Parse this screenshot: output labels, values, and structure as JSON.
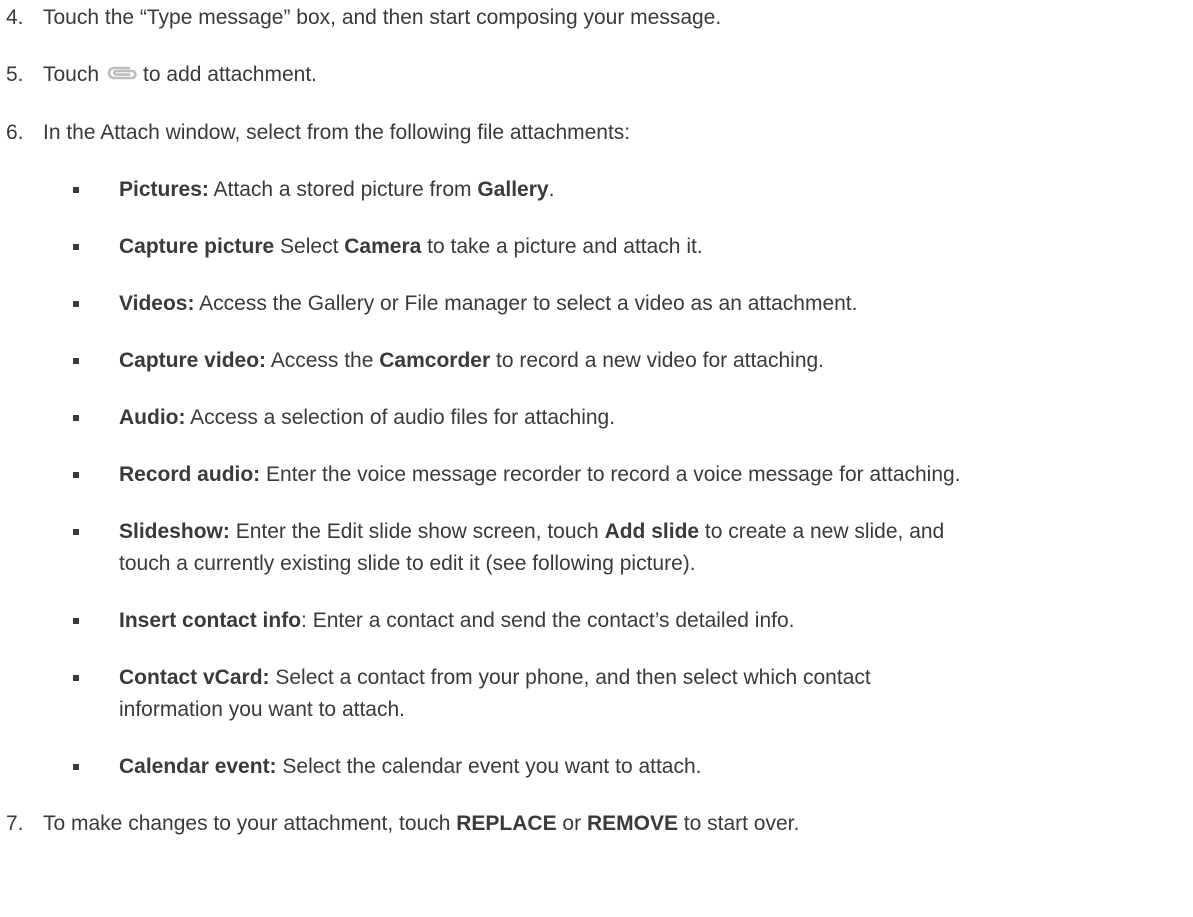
{
  "steps": [
    {
      "number": "4.",
      "text": "Touch the “Type message” box, and then start composing your message."
    },
    {
      "number": "5.",
      "text_before": "Touch",
      "icon": "paperclip-icon",
      "text_after": "to add attachment."
    },
    {
      "number": "6.",
      "text": "In the Attach window, select from the following file attachments:"
    },
    {
      "number": "7.",
      "text_before": "To make changes to your attachment, touch ",
      "bold1": "REPLACE",
      "text_middle": " or ",
      "bold2": "REMOVE",
      "text_after": " to start over."
    }
  ],
  "attachments": [
    {
      "label": "Pictures:",
      "text_a": " Attach a stored picture from ",
      "bold": "Gallery",
      "text_b": "."
    },
    {
      "label": "Capture picture",
      "text_a": " Select ",
      "bold": "Camera",
      "text_b": " to take a picture and attach it."
    },
    {
      "label": "Videos:",
      "text_a": " Access the Gallery or File manager to select a video as an attachment."
    },
    {
      "label": "Capture video:",
      "text_a": " Access the ",
      "bold": "Camcorder",
      "text_b": " to record a new video for attaching."
    },
    {
      "label": "Audio:",
      "text_a": " Access a selection of audio files for attaching."
    },
    {
      "label": "Record audio:",
      "text_a": " Enter the voice message recorder to record a voice message for attaching."
    },
    {
      "label": "Slideshow:",
      "text_a": " Enter the Edit slide show screen, touch ",
      "bold": "Add slide",
      "text_b": " to create a new slide, and",
      "line2": "touch a currently existing slide to edit it (see following picture)."
    },
    {
      "label": "Insert contact info",
      "text_a": ": Enter a contact and send the contact’s detailed info."
    },
    {
      "label": "Contact vCard:",
      "text_a": " Select a contact from your phone, and then select which contact",
      "line2": "information you want to attach."
    },
    {
      "label": "Calendar event:",
      "text_a": " Select the calendar event you want to attach."
    }
  ]
}
